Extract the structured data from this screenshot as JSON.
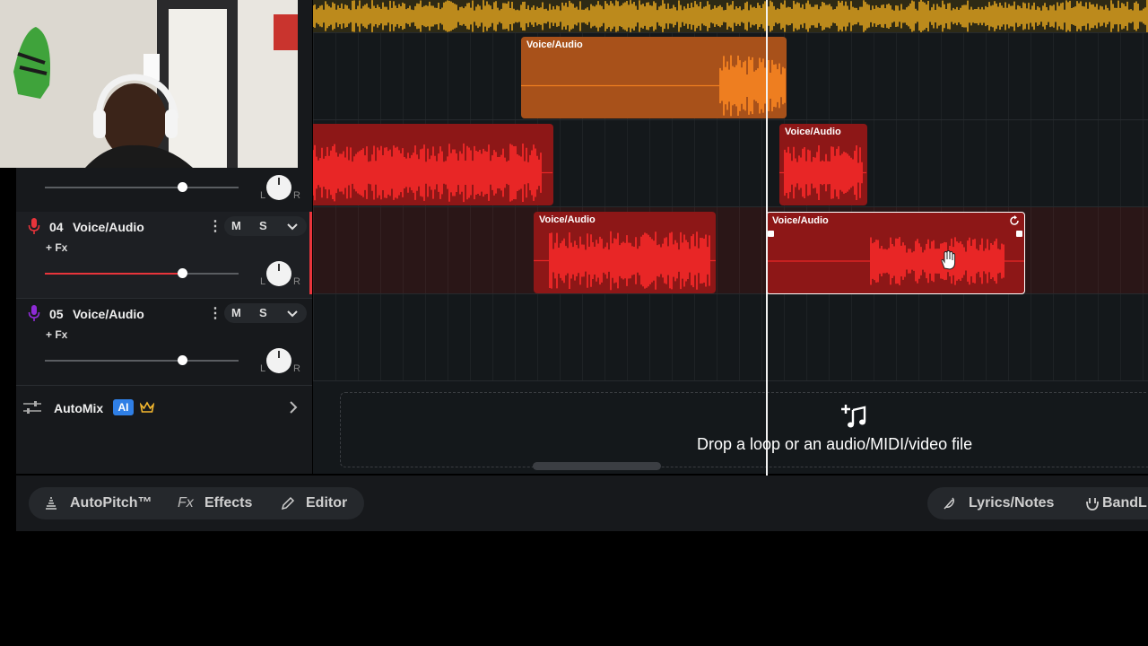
{
  "colors": {
    "accent_orange": "#f5a623",
    "clip_orange": "#f07a1a",
    "clip_red": "#ee1f1f",
    "track4_icon": "#e8343b",
    "track5_icon": "#8e2bd6",
    "ai_badge": "#2f7fe6",
    "crown": "#f5b82e"
  },
  "tracks": [
    {
      "number": "04",
      "name": "Voice/Audio",
      "fx": "+ Fx",
      "mute": "M",
      "solo": "S",
      "kebab": "⋮",
      "volume_fraction": 0.7,
      "pan_left": "L",
      "pan_right": "R",
      "icon": "microphone-icon"
    },
    {
      "number": "05",
      "name": "Voice/Audio",
      "fx": "+ Fx",
      "mute": "M",
      "solo": "S",
      "kebab": "⋮",
      "volume_fraction": 0.7,
      "pan_left": "L",
      "pan_right": "R",
      "icon": "microphone-icon"
    }
  ],
  "partial_track": {
    "volume_fraction": 0.7,
    "pan_left": "L",
    "pan_right": "R"
  },
  "clips": {
    "lane2_clip1": "Voice/Audio",
    "lane3_clip2": "Voice/Audio",
    "lane4_clip1": "Voice/Audio",
    "lane4_clip2": "Voice/Audio"
  },
  "automix": {
    "label": "AutoMix",
    "badge": "AI",
    "icon": "crown-icon"
  },
  "drop_zone": {
    "text": "Drop a loop or an audio/MIDI/video file",
    "icon": "add-music-icon"
  },
  "bottom_tools": {
    "autopitch": "AutoPitch™",
    "effects_prefix": "Fx",
    "effects": "Effects",
    "editor": "Editor",
    "lyrics": "Lyrics/Notes",
    "bandlab": "BandL"
  }
}
